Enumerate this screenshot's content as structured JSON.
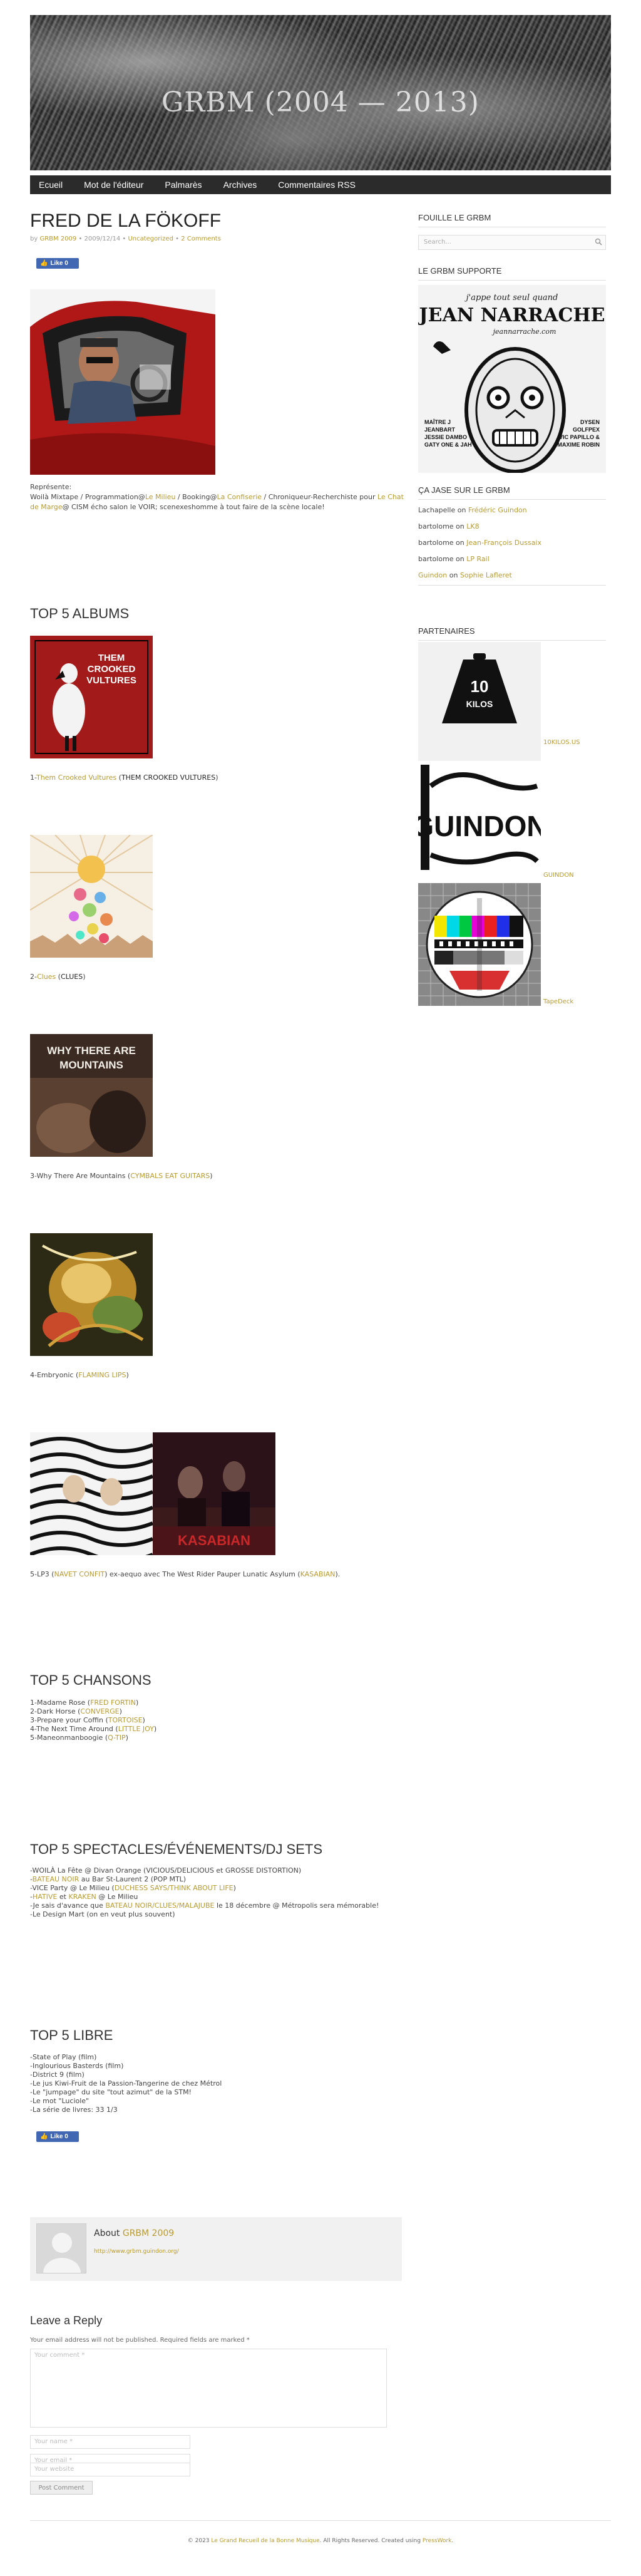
{
  "site": {
    "title": "GRBM (2004 — 2013)"
  },
  "nav": {
    "items": [
      "Ecueil",
      "Mot de l'éditeur",
      "Palmarès",
      "Archives",
      "Commentaires RSS"
    ]
  },
  "post": {
    "title": "FRED DE LA FÖKOFF",
    "meta": {
      "by": "by",
      "author": "GRBM 2009",
      "date": "2009/12/14",
      "category": "Uncategorized",
      "comments": "2 Comments"
    },
    "like_label": "Like 0",
    "represente_label": "Représente:",
    "bio_line1_parts": [
      {
        "text": "Woilà Mixtape / Programmation@",
        "link": false
      },
      {
        "text": "Le Milieu",
        "link": true
      },
      {
        "text": " / Booking@",
        "link": false
      },
      {
        "text": "La Confiserie",
        "link": true
      },
      {
        "text": " / Chroniqueur-Recherchiste pour ",
        "link": false
      },
      {
        "text": "Le Chat",
        "link": true
      }
    ],
    "bio_line2_parts": [
      {
        "text": "de Marge",
        "link": true
      },
      {
        "text": "@ CISM écho salon le VOIR; scenexeshomme à tout faire de la scène locale!",
        "link": false
      }
    ]
  },
  "top_albums": {
    "heading": "TOP 5 ALBUMS",
    "items": [
      {
        "prefix": "1-",
        "title": "Them Crooked Vultures",
        "artist": "THEM CROOKED VULTURES",
        "title_link": true,
        "artist_link": false,
        "cover_text": "THEM CROOKED VULTURES"
      },
      {
        "prefix": "2-",
        "title": "Clues",
        "artist": "CLUES",
        "title_link": true,
        "artist_link": false,
        "cover_text": ""
      },
      {
        "prefix": "3-",
        "title": "Why There Are Mountains",
        "artist": "CYMBALS EAT GUITARS",
        "title_link": false,
        "artist_link": true,
        "cover_text": "WHY THERE ARE MOUNTAINS"
      },
      {
        "prefix": "4-",
        "title": "Embryonic",
        "artist": "FLAMING LIPS",
        "title_link": false,
        "artist_link": true,
        "cover_text": ""
      },
      {
        "prefix": "5-",
        "title": "LP3",
        "artist": "NAVET CONFIT",
        "title_link": false,
        "artist_link": true,
        "tail": " ex-aequo avec The West Rider Pauper Lunatic Asylum (",
        "artist2": "KASABIAN",
        "cover_text": "KASABIAN"
      }
    ]
  },
  "top_songs": {
    "heading": "TOP 5 CHANSONS",
    "items": [
      {
        "text": "1-Madame Rose (",
        "artist": "FRED FORTIN"
      },
      {
        "text": "2-Dark Horse (",
        "artist": "CONVERGE"
      },
      {
        "text": "3-Prepare your Coffin (",
        "artist": "TORTOISE"
      },
      {
        "text": "4-The Next Time Around (",
        "artist": "LITTLE JOY"
      },
      {
        "text": "5-Maneonmanboogie (",
        "artist": "Q-TIP"
      }
    ]
  },
  "top_shows": {
    "heading": "TOP 5 SPECTACLES/ÉVÉNEMENTS/DJ SETS",
    "lines": [
      [
        {
          "text": "-WOILÀ La Fête @ Divan Orange (VICIOUS/DELICIOUS et GROSSE DISTORTION)",
          "link": false
        }
      ],
      [
        {
          "text": "-",
          "link": false
        },
        {
          "text": "BATEAU NOIR",
          "link": true
        },
        {
          "text": " au Bar St-Laurent 2 (POP MTL)",
          "link": false
        }
      ],
      [
        {
          "text": "-VICE Party @ Le Milieu (",
          "link": false
        },
        {
          "text": "DUCHESS SAYS/THINK ABOUT LIFE",
          "link": true
        },
        {
          "text": ")",
          "link": false
        }
      ],
      [
        {
          "text": "-",
          "link": false
        },
        {
          "text": "HATIVE",
          "link": true
        },
        {
          "text": " et ",
          "link": false
        },
        {
          "text": "KRAKEN",
          "link": true
        },
        {
          "text": " @ Le Milieu",
          "link": false
        }
      ],
      [
        {
          "text": "-Je sais d'avance que ",
          "link": false
        },
        {
          "text": "BATEAU NOIR/CLUES/MALAJUBE",
          "link": true
        },
        {
          "text": " le 18 décembre @ Métropolis sera mémorable!",
          "link": false
        }
      ],
      [
        {
          "text": "-Le Design Mart (on en veut plus souvent)",
          "link": false
        }
      ]
    ]
  },
  "top_libre": {
    "heading": "TOP 5 LIBRE",
    "lines": [
      "-State of Play (film)",
      "-Inglourious Basterds (film)",
      "-District 9 (film)",
      "-Le jus Kiwi-Fruit de la Passion-Tangerine de chez Métrol",
      "-Le \"jumpage\" du site \"tout azimut\" de la STM!",
      "-Le mot \"Luciole\"",
      "-La série de livres: 33 1/3"
    ]
  },
  "author_box": {
    "about_label": "About ",
    "author": "GRBM 2009",
    "url": "http://www.grbm.guindon.org/"
  },
  "reply": {
    "heading": "Leave a Reply",
    "notice": "Your email address will not be published. Required fields are marked *",
    "comment_placeholder": "Your comment *",
    "name_placeholder": "Your name *",
    "email_placeholder": "Your email *",
    "website_placeholder": "Your website",
    "submit_label": "Post Comment"
  },
  "footer": {
    "prefix": "© 2023 ",
    "site_link": "Le Grand Recueil de la Bonne Musique",
    "middle": ". All Rights Reserved. Created using ",
    "theme_link": "PressWork",
    "suffix": "."
  },
  "sidebar": {
    "search_heading": "FOUILLE LE GRBM",
    "search_placeholder": "Search...",
    "supports_heading": "LE GRBM SUPPORTE",
    "poster": {
      "line1": "j'appe tout seul quand",
      "name": "JEAN NARRACHE",
      "site": "jeannarrache.com",
      "left_lines": [
        "MAÎTRE J",
        "JEANBART",
        "JESSIE DAMBO",
        "GATY ONE & JAH"
      ],
      "right_lines": [
        "DYSEN",
        "GOLFPEX",
        "VIC PAPILLO &",
        "MAXIME ROBIN"
      ]
    },
    "comments_heading": "ÇA JASE SUR LE GRBM",
    "recent_comments": [
      {
        "who": "Lachapelle",
        "on": " on ",
        "post": "Frédéric Guindon",
        "who_link": false
      },
      {
        "who": "bartolome",
        "on": " on ",
        "post": "LK8",
        "who_link": false
      },
      {
        "who": "bartolome",
        "on": " on ",
        "post": "Jean-François Dussaix",
        "who_link": false
      },
      {
        "who": "bartolome",
        "on": " on ",
        "post": "LP Rail",
        "who_link": false
      },
      {
        "who": "Guindon",
        "on": " on ",
        "post": "Sophie Lafleret",
        "who_link": true
      }
    ],
    "partners_heading": "PARTENAIRES",
    "partners": [
      {
        "label": "10KILOS.US",
        "image_text": "10 KILOS"
      },
      {
        "label": "GUINDON",
        "image_text": "GUINDON"
      },
      {
        "label": "TapeDeck",
        "image_text": ""
      }
    ]
  },
  "colors": {
    "link": "#b89a2e",
    "nav_bg": "#2b2b2b",
    "like_blue": "#4267b2"
  }
}
